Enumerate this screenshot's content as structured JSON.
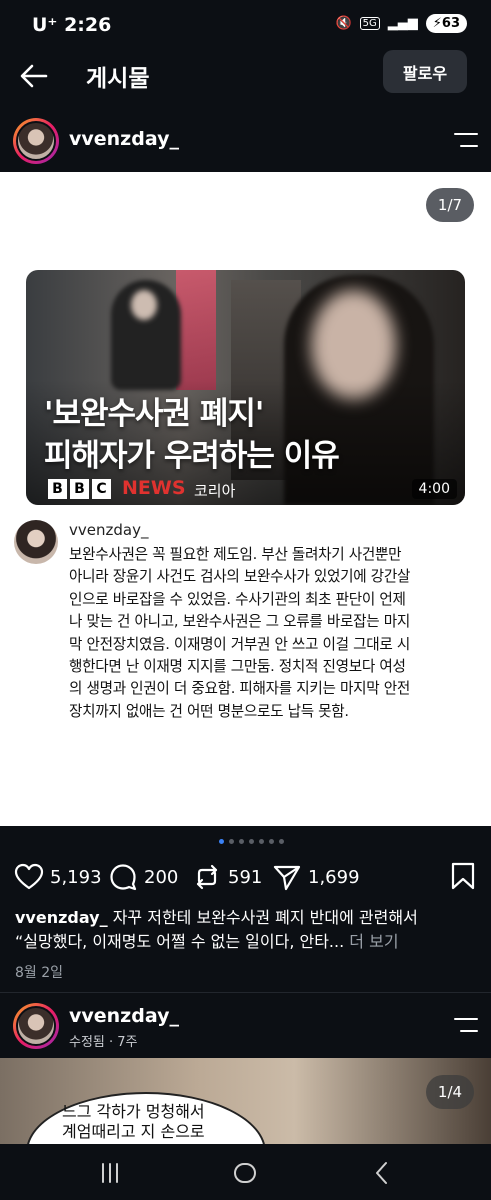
{
  "status_bar": {
    "carrier": "U⁺ 2:26",
    "network": "5G",
    "battery": "63"
  },
  "header": {
    "title": "게시물",
    "follow_label": "팔로우"
  },
  "author": {
    "username": "vvenzday_"
  },
  "post_image": {
    "counter": "1/7",
    "video": {
      "headline_line1": "'보완수사권 폐지'",
      "headline_line2": "피해자가 우려하는 이유",
      "brand_news": "NEWS",
      "brand_region": "코리아",
      "duration": "4:00"
    },
    "inner_comment": {
      "username": "vvenzday_",
      "lines": [
        "보완수사권은 꼭 필요한 제도임. 부산 돌려차기 사건뿐만",
        "아니라 장윤기 사건도 검사의 보완수사가 있었기에 강간살",
        "인으로 바로잡을 수 있었음. 수사기관의 최초 판단이 언제",
        "나 맞는 건 아니고, 보완수사권은 그 오류를 바로잡는 마지",
        "막 안전장치였음. 이재명이 거부권 안 쓰고 이걸 그대로 시",
        "행한다면 난 이재명 지지를 그만둠. 정치적 진영보다 여성",
        "의 생명과 인권이 더 중요함. 피해자를 지키는 마지막 안전",
        "장치까지 없애는 건 어떤 명분으로도 납득 못함."
      ]
    }
  },
  "actions": {
    "likes": "5,193",
    "comments": "200",
    "reposts": "591",
    "shares": "1,699"
  },
  "caption": {
    "username": "vvenzday_",
    "line1": "자꾸 저한테 보완수사권 폐지 반대에 관련해서",
    "line2": "“실망했다, 이재명도 어쩔 수 없는 일이다, 안타...",
    "more": "더 보기",
    "date": "8월 2일"
  },
  "next_post": {
    "username": "vvenzday_",
    "meta": "수정됨 · 7주",
    "counter": "1/4",
    "bubble_line1": "느그 각하가 멍청해서",
    "bubble_line2": "계엄때리고 지 손으로"
  }
}
